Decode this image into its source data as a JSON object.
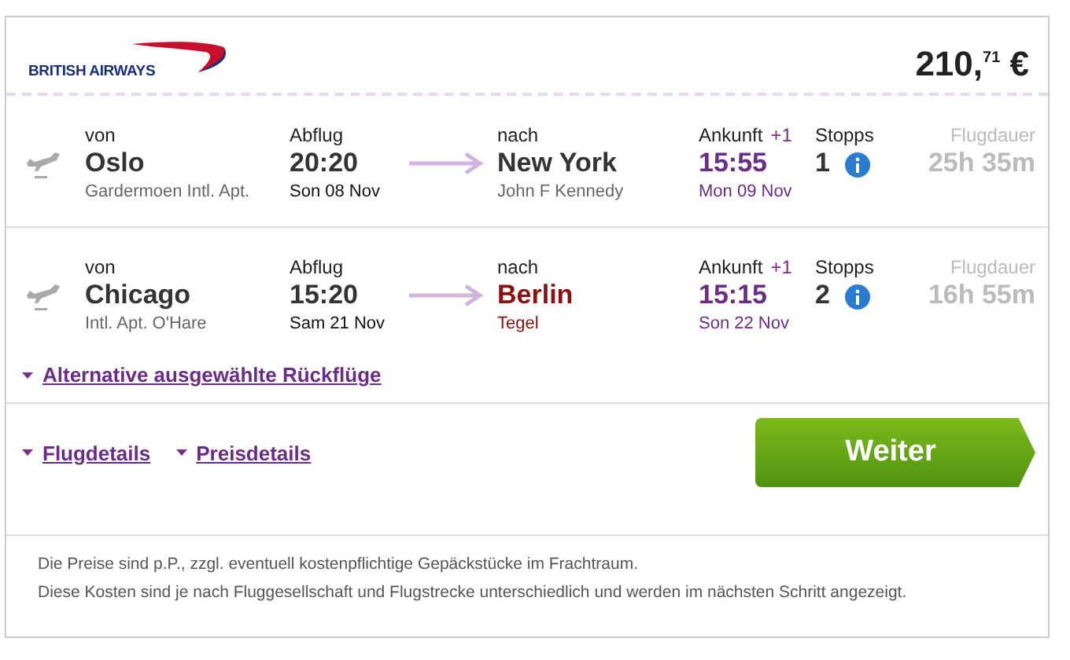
{
  "airline": {
    "name": "BRITISH AIRWAYS"
  },
  "price": "210,$^{71}$ €",
  "flights": [
    {
      "from_label": "von",
      "from_city": "Oslo",
      "from_airport": "Gardermoen Intl. Apt.",
      "dep_label": "Abflug",
      "dep_time": "20:20",
      "dep_date": "Son 08 Nov",
      "to_label": "nach",
      "to_city": "New York",
      "to_airport": "John F Kennedy",
      "to_highlight": false,
      "arr_label": "Ankunft",
      "arr_offset": "+1",
      "arr_time": "15:55",
      "arr_date": "Mon 09 Nov",
      "stops_label": "Stopps",
      "stops": "1",
      "duration_label": "Flugdauer",
      "duration": "25h 35m"
    },
    {
      "from_label": "von",
      "from_city": "Chicago",
      "from_airport": "Intl. Apt. O'Hare",
      "dep_label": "Abflug",
      "dep_time": "15:20",
      "dep_date": "Sam 21 Nov",
      "to_label": "nach",
      "to_city": "Berlin",
      "to_airport": "Tegel",
      "to_highlight": true,
      "arr_label": "Ankunft",
      "arr_offset": "+1",
      "arr_time": "15:15",
      "arr_date": "Son 22 Nov",
      "stops_label": "Stopps",
      "stops": "2",
      "duration_label": "Flugdauer",
      "duration": "16h 55m"
    }
  ],
  "alternative_link": "Alternative ausgewählte Rückflüge",
  "detail_links": [
    "Flugdetails",
    "Preisdetails"
  ],
  "continue_button": "Weiter",
  "footnotes": [
    "Die Preise sind p.P., zzgl. eventuell kostenpflichtige Gepäckstücke im Frachtraum.",
    "Diese Kosten sind je nach Fluggesellschaft und Flugstrecke unterschiedlich und werden im nächsten Schritt angezeigt."
  ]
}
